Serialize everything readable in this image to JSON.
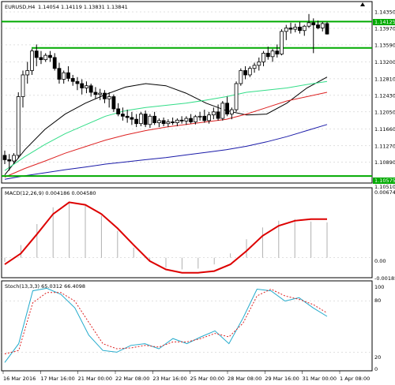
{
  "header": {
    "symbol_tf": "EURUSD,H4",
    "ohlc": "1.14054 1.14119 1.13831 1.13841"
  },
  "colors": {
    "candle": "#000000",
    "level_line": "#00aa00",
    "ma_black": "#000000",
    "ma_green": "#33dd88",
    "ma_red": "#dd2222",
    "ma_blue": "#1a1aa8",
    "macd_signal": "#dd0000",
    "macd_hist": "#b0b0b0",
    "stoch_main": "#22aacc",
    "stoch_signal": "#dd2222",
    "grid": "#c0c0c0",
    "price_tag_bg": "#00aa00",
    "price_tag_text": "#ffffff"
  },
  "price_axis": {
    "ticks": [
      "1.14350",
      "1.13970",
      "1.13590",
      "1.13200",
      "1.12810",
      "1.12430",
      "1.12050",
      "1.11660",
      "1.11270",
      "1.10890"
    ],
    "current_price_tag": "1.14125",
    "bottom_price_tag": "1.10575",
    "bottom_extra": "1.10510"
  },
  "levels": [
    1.14125,
    1.1352,
    1.10575
  ],
  "macd": {
    "label": "MACD(12,26,9) 0.004186 0.004580",
    "ticks": [
      "0.006745",
      "0.00",
      "-0.00185"
    ]
  },
  "stoch": {
    "label": "Stoch(13,3,3) 65.0312 66.4098",
    "ticks": [
      "100",
      "80",
      "20",
      "0"
    ]
  },
  "time_axis": [
    "16 Mar 2016",
    "17 Mar 16:00",
    "21 Mar 00:00",
    "22 Mar 08:00",
    "23 Mar 16:00",
    "25 Mar 00:00",
    "28 Mar 08:00",
    "29 Mar 16:00",
    "31 Mar 00:00",
    "1 Apr 08:00"
  ],
  "chart_data": {
    "type": "candlestick",
    "symbol": "EURUSD",
    "timeframe": "H4",
    "candles": [
      [
        1.1105,
        1.1116,
        1.1085,
        1.1095
      ],
      [
        1.1095,
        1.1108,
        1.107,
        1.1092
      ],
      [
        1.1092,
        1.111,
        1.1085,
        1.1105
      ],
      [
        1.1105,
        1.125,
        1.1098,
        1.124
      ],
      [
        1.124,
        1.13,
        1.1215,
        1.129
      ],
      [
        1.129,
        1.132,
        1.127,
        1.13
      ],
      [
        1.13,
        1.135,
        1.129,
        1.1345
      ],
      [
        1.1345,
        1.136,
        1.131,
        1.133
      ],
      [
        1.133,
        1.1345,
        1.1315,
        1.1325
      ],
      [
        1.1325,
        1.134,
        1.132,
        1.1335
      ],
      [
        1.1335,
        1.1345,
        1.132,
        1.133
      ],
      [
        1.133,
        1.134,
        1.13,
        1.1305
      ],
      [
        1.1305,
        1.1318,
        1.127,
        1.128
      ],
      [
        1.128,
        1.13,
        1.127,
        1.1295
      ],
      [
        1.1295,
        1.131,
        1.1275,
        1.1282
      ],
      [
        1.1282,
        1.129,
        1.1265,
        1.1275
      ],
      [
        1.1275,
        1.1285,
        1.1255,
        1.127
      ],
      [
        1.127,
        1.128,
        1.1245,
        1.126
      ],
      [
        1.126,
        1.1275,
        1.1248,
        1.1265
      ],
      [
        1.1265,
        1.127,
        1.124,
        1.125
      ],
      [
        1.125,
        1.1262,
        1.1235,
        1.1245
      ],
      [
        1.1245,
        1.1258,
        1.1232,
        1.1248
      ],
      [
        1.1248,
        1.1255,
        1.1225,
        1.1235
      ],
      [
        1.1235,
        1.125,
        1.1215,
        1.124
      ],
      [
        1.124,
        1.1245,
        1.1205,
        1.1212
      ],
      [
        1.1212,
        1.1225,
        1.1195,
        1.12
      ],
      [
        1.12,
        1.1215,
        1.1185,
        1.1195
      ],
      [
        1.1195,
        1.121,
        1.118,
        1.1192
      ],
      [
        1.1192,
        1.1205,
        1.1175,
        1.1188
      ],
      [
        1.1188,
        1.12,
        1.117,
        1.1178
      ],
      [
        1.1178,
        1.1205,
        1.1172,
        1.12
      ],
      [
        1.12,
        1.1208,
        1.117,
        1.1176
      ],
      [
        1.1176,
        1.12,
        1.1168,
        1.1195
      ],
      [
        1.1195,
        1.1205,
        1.1175,
        1.118
      ],
      [
        1.118,
        1.119,
        1.117,
        1.1185
      ],
      [
        1.1185,
        1.1192,
        1.1172,
        1.1178
      ],
      [
        1.1178,
        1.1188,
        1.117,
        1.1182
      ],
      [
        1.1182,
        1.1192,
        1.1175,
        1.118
      ],
      [
        1.118,
        1.119,
        1.1172,
        1.1186
      ],
      [
        1.1186,
        1.1195,
        1.1178,
        1.1184
      ],
      [
        1.1184,
        1.1195,
        1.1175,
        1.119
      ],
      [
        1.119,
        1.12,
        1.1178,
        1.1182
      ],
      [
        1.1182,
        1.1198,
        1.1176,
        1.1194
      ],
      [
        1.1194,
        1.1205,
        1.1185,
        1.1195
      ],
      [
        1.1195,
        1.121,
        1.118,
        1.1185
      ],
      [
        1.1185,
        1.1205,
        1.1178,
        1.1198
      ],
      [
        1.1198,
        1.1215,
        1.1188,
        1.1205
      ],
      [
        1.1205,
        1.1222,
        1.1185,
        1.119
      ],
      [
        1.119,
        1.123,
        1.1185,
        1.1225
      ],
      [
        1.1225,
        1.124,
        1.1195,
        1.12
      ],
      [
        1.12,
        1.1215,
        1.1188,
        1.121
      ],
      [
        1.121,
        1.1275,
        1.1205,
        1.127
      ],
      [
        1.127,
        1.1305,
        1.1265,
        1.13
      ],
      [
        1.13,
        1.131,
        1.128,
        1.129
      ],
      [
        1.129,
        1.131,
        1.1285,
        1.1305
      ],
      [
        1.1305,
        1.1318,
        1.1295,
        1.1312
      ],
      [
        1.1312,
        1.133,
        1.13,
        1.132
      ],
      [
        1.132,
        1.1345,
        1.131,
        1.134
      ],
      [
        1.134,
        1.1355,
        1.1325,
        1.1332
      ],
      [
        1.1332,
        1.135,
        1.132,
        1.1345
      ],
      [
        1.1345,
        1.136,
        1.133,
        1.1338
      ],
      [
        1.1338,
        1.1395,
        1.1335,
        1.139
      ],
      [
        1.139,
        1.1405,
        1.137,
        1.1398
      ],
      [
        1.1398,
        1.141,
        1.1385,
        1.1395
      ],
      [
        1.1395,
        1.1408,
        1.1388,
        1.14
      ],
      [
        1.14,
        1.1412,
        1.1385,
        1.1392
      ],
      [
        1.1392,
        1.1405,
        1.138,
        1.1402
      ],
      [
        1.1402,
        1.143,
        1.1398,
        1.141
      ],
      [
        1.141,
        1.142,
        1.134,
        1.1405
      ],
      [
        1.1405,
        1.1415,
        1.1395,
        1.1398
      ],
      [
        1.1398,
        1.1412,
        1.139,
        1.1408
      ],
      [
        1.1408,
        1.1412,
        1.1383,
        1.1384
      ]
    ],
    "ma_black": [
      1.106,
      1.1118,
      1.1165,
      1.12,
      1.1225,
      1.1245,
      1.1262,
      1.127,
      1.1265,
      1.1248,
      1.1225,
      1.1208,
      1.1198,
      1.12,
      1.1225,
      1.126,
      1.1285
    ],
    "ma_green": [
      1.107,
      1.1102,
      1.113,
      1.1155,
      1.1175,
      1.1195,
      1.1208,
      1.1215,
      1.122,
      1.1225,
      1.1232,
      1.124,
      1.125,
      1.1255,
      1.126,
      1.1268,
      1.1275
    ],
    "ma_red": [
      1.1055,
      1.1075,
      1.1092,
      1.111,
      1.1125,
      1.114,
      1.1152,
      1.1162,
      1.117,
      1.1176,
      1.1182,
      1.1188,
      1.12,
      1.1215,
      1.123,
      1.124,
      1.125
    ],
    "ma_blue": [
      1.105,
      1.1058,
      1.1065,
      1.1072,
      1.1078,
      1.1085,
      1.109,
      1.1095,
      1.11,
      1.1106,
      1.1112,
      1.1118,
      1.1126,
      1.1136,
      1.1148,
      1.1162,
      1.1176
    ],
    "macd_hist": [
      -0.0005,
      0.0015,
      0.004,
      0.006,
      0.0066,
      0.0062,
      0.005,
      0.0032,
      0.0012,
      -0.0005,
      -0.0012,
      -0.0014,
      -0.0013,
      -0.0008,
      0.0005,
      0.0022,
      0.0036,
      0.0044,
      0.0046,
      0.0043,
      0.0042
    ],
    "macd_signal": [
      -0.0008,
      0.0005,
      0.0028,
      0.0052,
      0.0066,
      0.0063,
      0.0052,
      0.0035,
      0.0015,
      -0.0004,
      -0.0014,
      -0.0018,
      -0.0018,
      -0.0016,
      -0.0008,
      0.0008,
      0.0026,
      0.0038,
      0.0044,
      0.0046,
      0.0046
    ],
    "stoch_main": [
      8,
      30,
      92,
      95,
      88,
      72,
      40,
      22,
      20,
      28,
      30,
      24,
      36,
      30,
      38,
      45,
      30,
      60,
      94,
      92,
      80,
      84,
      72,
      62
    ],
    "stoch_signal": [
      18,
      22,
      78,
      90,
      90,
      80,
      55,
      30,
      24,
      25,
      28,
      26,
      32,
      32,
      36,
      42,
      38,
      54,
      86,
      94,
      86,
      82,
      76,
      66
    ]
  }
}
